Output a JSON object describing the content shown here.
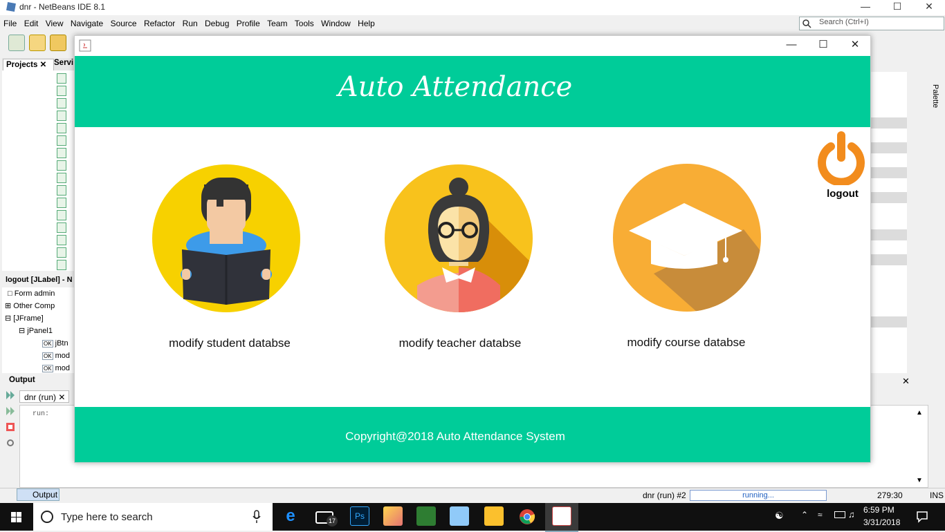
{
  "ide": {
    "title": "dnr - NetBeans IDE 8.1",
    "menu": [
      "File",
      "Edit",
      "View",
      "Navigate",
      "Source",
      "Refactor",
      "Run",
      "Debug",
      "Profile",
      "Team",
      "Tools",
      "Window",
      "Help"
    ],
    "search_placeholder": "Search (Ctrl+I)",
    "tabs": {
      "projects": "Projects",
      "services": "Servi"
    },
    "navigator_title": "logout [JLabel] - N",
    "navigator_items": [
      "Form admin",
      "Other Comp",
      "[JFrame]",
      "jPanel1",
      "jBtn",
      "mod",
      "mod"
    ],
    "output_title": "Output",
    "output_tab": "dnr (run)",
    "output_text": "run:",
    "palette": "Palette",
    "status": {
      "output_tab": "Output",
      "run_label": "dnr (run) #2",
      "progress_text": "running...",
      "position": "279:30",
      "mode": "INS"
    }
  },
  "taskbar": {
    "search_placeholder": "Type here to search",
    "mail_badge": "17",
    "time": "6:59 PM",
    "date": "3/31/2018"
  },
  "app": {
    "title": "Auto Attendance",
    "cards": [
      {
        "label": "modify student databse",
        "icon": "student-icon"
      },
      {
        "label": "modify teacher databse",
        "icon": "teacher-icon"
      },
      {
        "label": "modify course databse",
        "icon": "graduation-cap-icon"
      }
    ],
    "logout_label": "logout",
    "footer": "Copyright@2018 Auto Attendance System",
    "colors": {
      "header": "#00cc99",
      "student_bg": "#f7d100",
      "teacher_bg": "#f8c21c",
      "course_bg": "#f8ad35",
      "logout": "#f28c1d"
    }
  }
}
